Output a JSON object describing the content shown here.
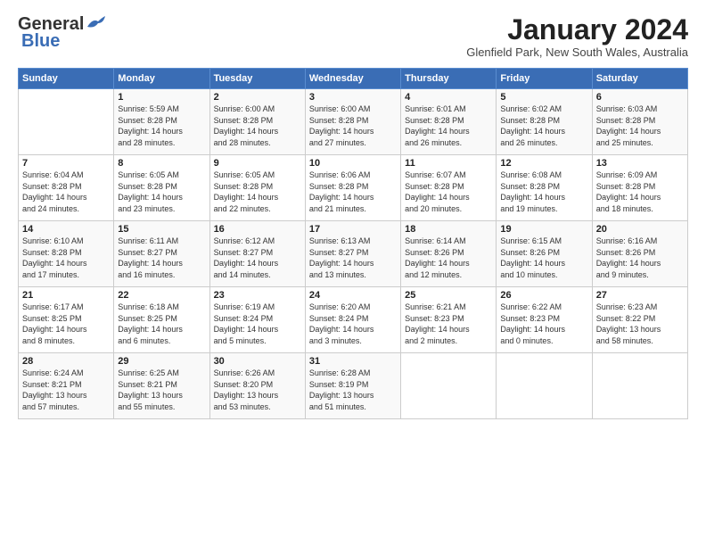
{
  "logo": {
    "line1": "General",
    "line2": "Blue"
  },
  "title": "January 2024",
  "subtitle": "Glenfield Park, New South Wales, Australia",
  "days_header": [
    "Sunday",
    "Monday",
    "Tuesday",
    "Wednesday",
    "Thursday",
    "Friday",
    "Saturday"
  ],
  "weeks": [
    [
      {
        "num": "",
        "info": ""
      },
      {
        "num": "1",
        "info": "Sunrise: 5:59 AM\nSunset: 8:28 PM\nDaylight: 14 hours\nand 28 minutes."
      },
      {
        "num": "2",
        "info": "Sunrise: 6:00 AM\nSunset: 8:28 PM\nDaylight: 14 hours\nand 28 minutes."
      },
      {
        "num": "3",
        "info": "Sunrise: 6:00 AM\nSunset: 8:28 PM\nDaylight: 14 hours\nand 27 minutes."
      },
      {
        "num": "4",
        "info": "Sunrise: 6:01 AM\nSunset: 8:28 PM\nDaylight: 14 hours\nand 26 minutes."
      },
      {
        "num": "5",
        "info": "Sunrise: 6:02 AM\nSunset: 8:28 PM\nDaylight: 14 hours\nand 26 minutes."
      },
      {
        "num": "6",
        "info": "Sunrise: 6:03 AM\nSunset: 8:28 PM\nDaylight: 14 hours\nand 25 minutes."
      }
    ],
    [
      {
        "num": "7",
        "info": "Sunrise: 6:04 AM\nSunset: 8:28 PM\nDaylight: 14 hours\nand 24 minutes."
      },
      {
        "num": "8",
        "info": "Sunrise: 6:05 AM\nSunset: 8:28 PM\nDaylight: 14 hours\nand 23 minutes."
      },
      {
        "num": "9",
        "info": "Sunrise: 6:05 AM\nSunset: 8:28 PM\nDaylight: 14 hours\nand 22 minutes."
      },
      {
        "num": "10",
        "info": "Sunrise: 6:06 AM\nSunset: 8:28 PM\nDaylight: 14 hours\nand 21 minutes."
      },
      {
        "num": "11",
        "info": "Sunrise: 6:07 AM\nSunset: 8:28 PM\nDaylight: 14 hours\nand 20 minutes."
      },
      {
        "num": "12",
        "info": "Sunrise: 6:08 AM\nSunset: 8:28 PM\nDaylight: 14 hours\nand 19 minutes."
      },
      {
        "num": "13",
        "info": "Sunrise: 6:09 AM\nSunset: 8:28 PM\nDaylight: 14 hours\nand 18 minutes."
      }
    ],
    [
      {
        "num": "14",
        "info": "Sunrise: 6:10 AM\nSunset: 8:28 PM\nDaylight: 14 hours\nand 17 minutes."
      },
      {
        "num": "15",
        "info": "Sunrise: 6:11 AM\nSunset: 8:27 PM\nDaylight: 14 hours\nand 16 minutes."
      },
      {
        "num": "16",
        "info": "Sunrise: 6:12 AM\nSunset: 8:27 PM\nDaylight: 14 hours\nand 14 minutes."
      },
      {
        "num": "17",
        "info": "Sunrise: 6:13 AM\nSunset: 8:27 PM\nDaylight: 14 hours\nand 13 minutes."
      },
      {
        "num": "18",
        "info": "Sunrise: 6:14 AM\nSunset: 8:26 PM\nDaylight: 14 hours\nand 12 minutes."
      },
      {
        "num": "19",
        "info": "Sunrise: 6:15 AM\nSunset: 8:26 PM\nDaylight: 14 hours\nand 10 minutes."
      },
      {
        "num": "20",
        "info": "Sunrise: 6:16 AM\nSunset: 8:26 PM\nDaylight: 14 hours\nand 9 minutes."
      }
    ],
    [
      {
        "num": "21",
        "info": "Sunrise: 6:17 AM\nSunset: 8:25 PM\nDaylight: 14 hours\nand 8 minutes."
      },
      {
        "num": "22",
        "info": "Sunrise: 6:18 AM\nSunset: 8:25 PM\nDaylight: 14 hours\nand 6 minutes."
      },
      {
        "num": "23",
        "info": "Sunrise: 6:19 AM\nSunset: 8:24 PM\nDaylight: 14 hours\nand 5 minutes."
      },
      {
        "num": "24",
        "info": "Sunrise: 6:20 AM\nSunset: 8:24 PM\nDaylight: 14 hours\nand 3 minutes."
      },
      {
        "num": "25",
        "info": "Sunrise: 6:21 AM\nSunset: 8:23 PM\nDaylight: 14 hours\nand 2 minutes."
      },
      {
        "num": "26",
        "info": "Sunrise: 6:22 AM\nSunset: 8:23 PM\nDaylight: 14 hours\nand 0 minutes."
      },
      {
        "num": "27",
        "info": "Sunrise: 6:23 AM\nSunset: 8:22 PM\nDaylight: 13 hours\nand 58 minutes."
      }
    ],
    [
      {
        "num": "28",
        "info": "Sunrise: 6:24 AM\nSunset: 8:21 PM\nDaylight: 13 hours\nand 57 minutes."
      },
      {
        "num": "29",
        "info": "Sunrise: 6:25 AM\nSunset: 8:21 PM\nDaylight: 13 hours\nand 55 minutes."
      },
      {
        "num": "30",
        "info": "Sunrise: 6:26 AM\nSunset: 8:20 PM\nDaylight: 13 hours\nand 53 minutes."
      },
      {
        "num": "31",
        "info": "Sunrise: 6:28 AM\nSunset: 8:19 PM\nDaylight: 13 hours\nand 51 minutes."
      },
      {
        "num": "",
        "info": ""
      },
      {
        "num": "",
        "info": ""
      },
      {
        "num": "",
        "info": ""
      }
    ]
  ]
}
